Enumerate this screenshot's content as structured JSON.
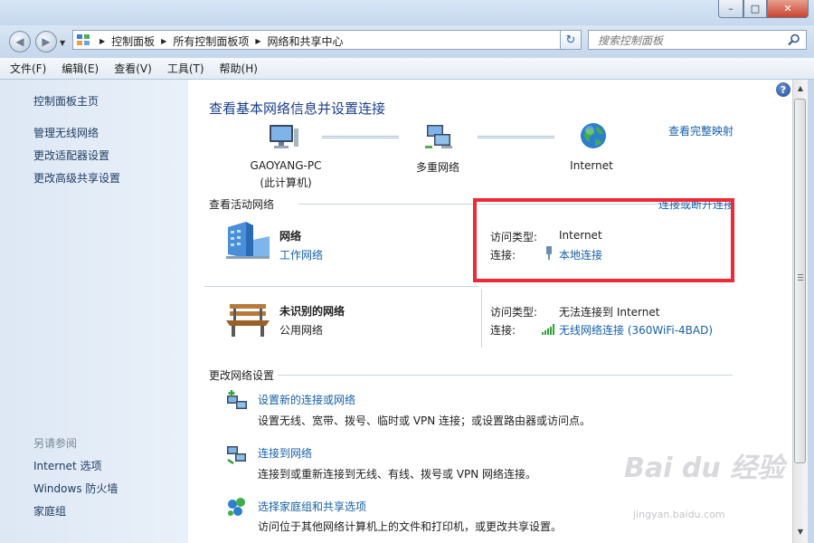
{
  "window": {
    "min_glyph": "–",
    "max_glyph": "□",
    "close_glyph": "✕"
  },
  "nav": {
    "back_glyph": "◀",
    "forward_glyph": "▶",
    "dropdown_glyph": "▼",
    "breadcrumbs": [
      "控制面板",
      "所有控制面板项",
      "网络和共享中心"
    ],
    "sep_glyph": "▶",
    "addr_dropdown_glyph": "▼",
    "refresh_glyph": "↻",
    "search_placeholder": "搜索控制面板"
  },
  "menu": {
    "items": [
      "文件(F)",
      "编辑(E)",
      "查看(V)",
      "工具(T)",
      "帮助(H)"
    ]
  },
  "sidebar": {
    "home": "控制面板主页",
    "links": [
      "管理无线网络",
      "更改适配器设置",
      "更改高级共享设置"
    ],
    "see_also_title": "另请参阅",
    "see_also": [
      "Internet 选项",
      "Windows 防火墙",
      "家庭组"
    ]
  },
  "main": {
    "help_glyph": "?",
    "title": "查看基本网络信息并设置连接",
    "map": {
      "computer_name": "GAOYANG-PC",
      "computer_sub": "(此计算机)",
      "middle": "多重网络",
      "internet": "Internet",
      "full_map_link": "查看完整映射"
    },
    "active": {
      "title": "查看活动网络",
      "connect_link": "连接或断开连接",
      "net1": {
        "name": "网络",
        "type": "工作网络",
        "access_label": "访问类型:",
        "access_value": "Internet",
        "conn_label": "连接:",
        "conn_value": "本地连接"
      },
      "net2": {
        "name": "未识别的网络",
        "type": "公用网络",
        "access_label": "访问类型:",
        "access_value": "无法连接到 Internet",
        "conn_label": "连接:",
        "conn_value": "无线网络连接 (360WiFi-4BAD)"
      }
    },
    "change": {
      "title": "更改网络设置",
      "items": [
        {
          "link": "设置新的连接或网络",
          "desc": "设置无线、宽带、拨号、临时或 VPN 连接；或设置路由器或访问点。"
        },
        {
          "link": "连接到网络",
          "desc": "连接到或重新连接到无线、有线、拨号或 VPN 网络连接。"
        },
        {
          "link": "选择家庭组和共享选项",
          "desc": "访问位于其他网络计算机上的文件和打印机，或更改共享设置。"
        }
      ]
    }
  },
  "scroll": {
    "up_glyph": "▲",
    "down_glyph": "▼"
  },
  "watermark": {
    "text": "Bai du 经验",
    "url": "jingyan.baidu.com"
  }
}
